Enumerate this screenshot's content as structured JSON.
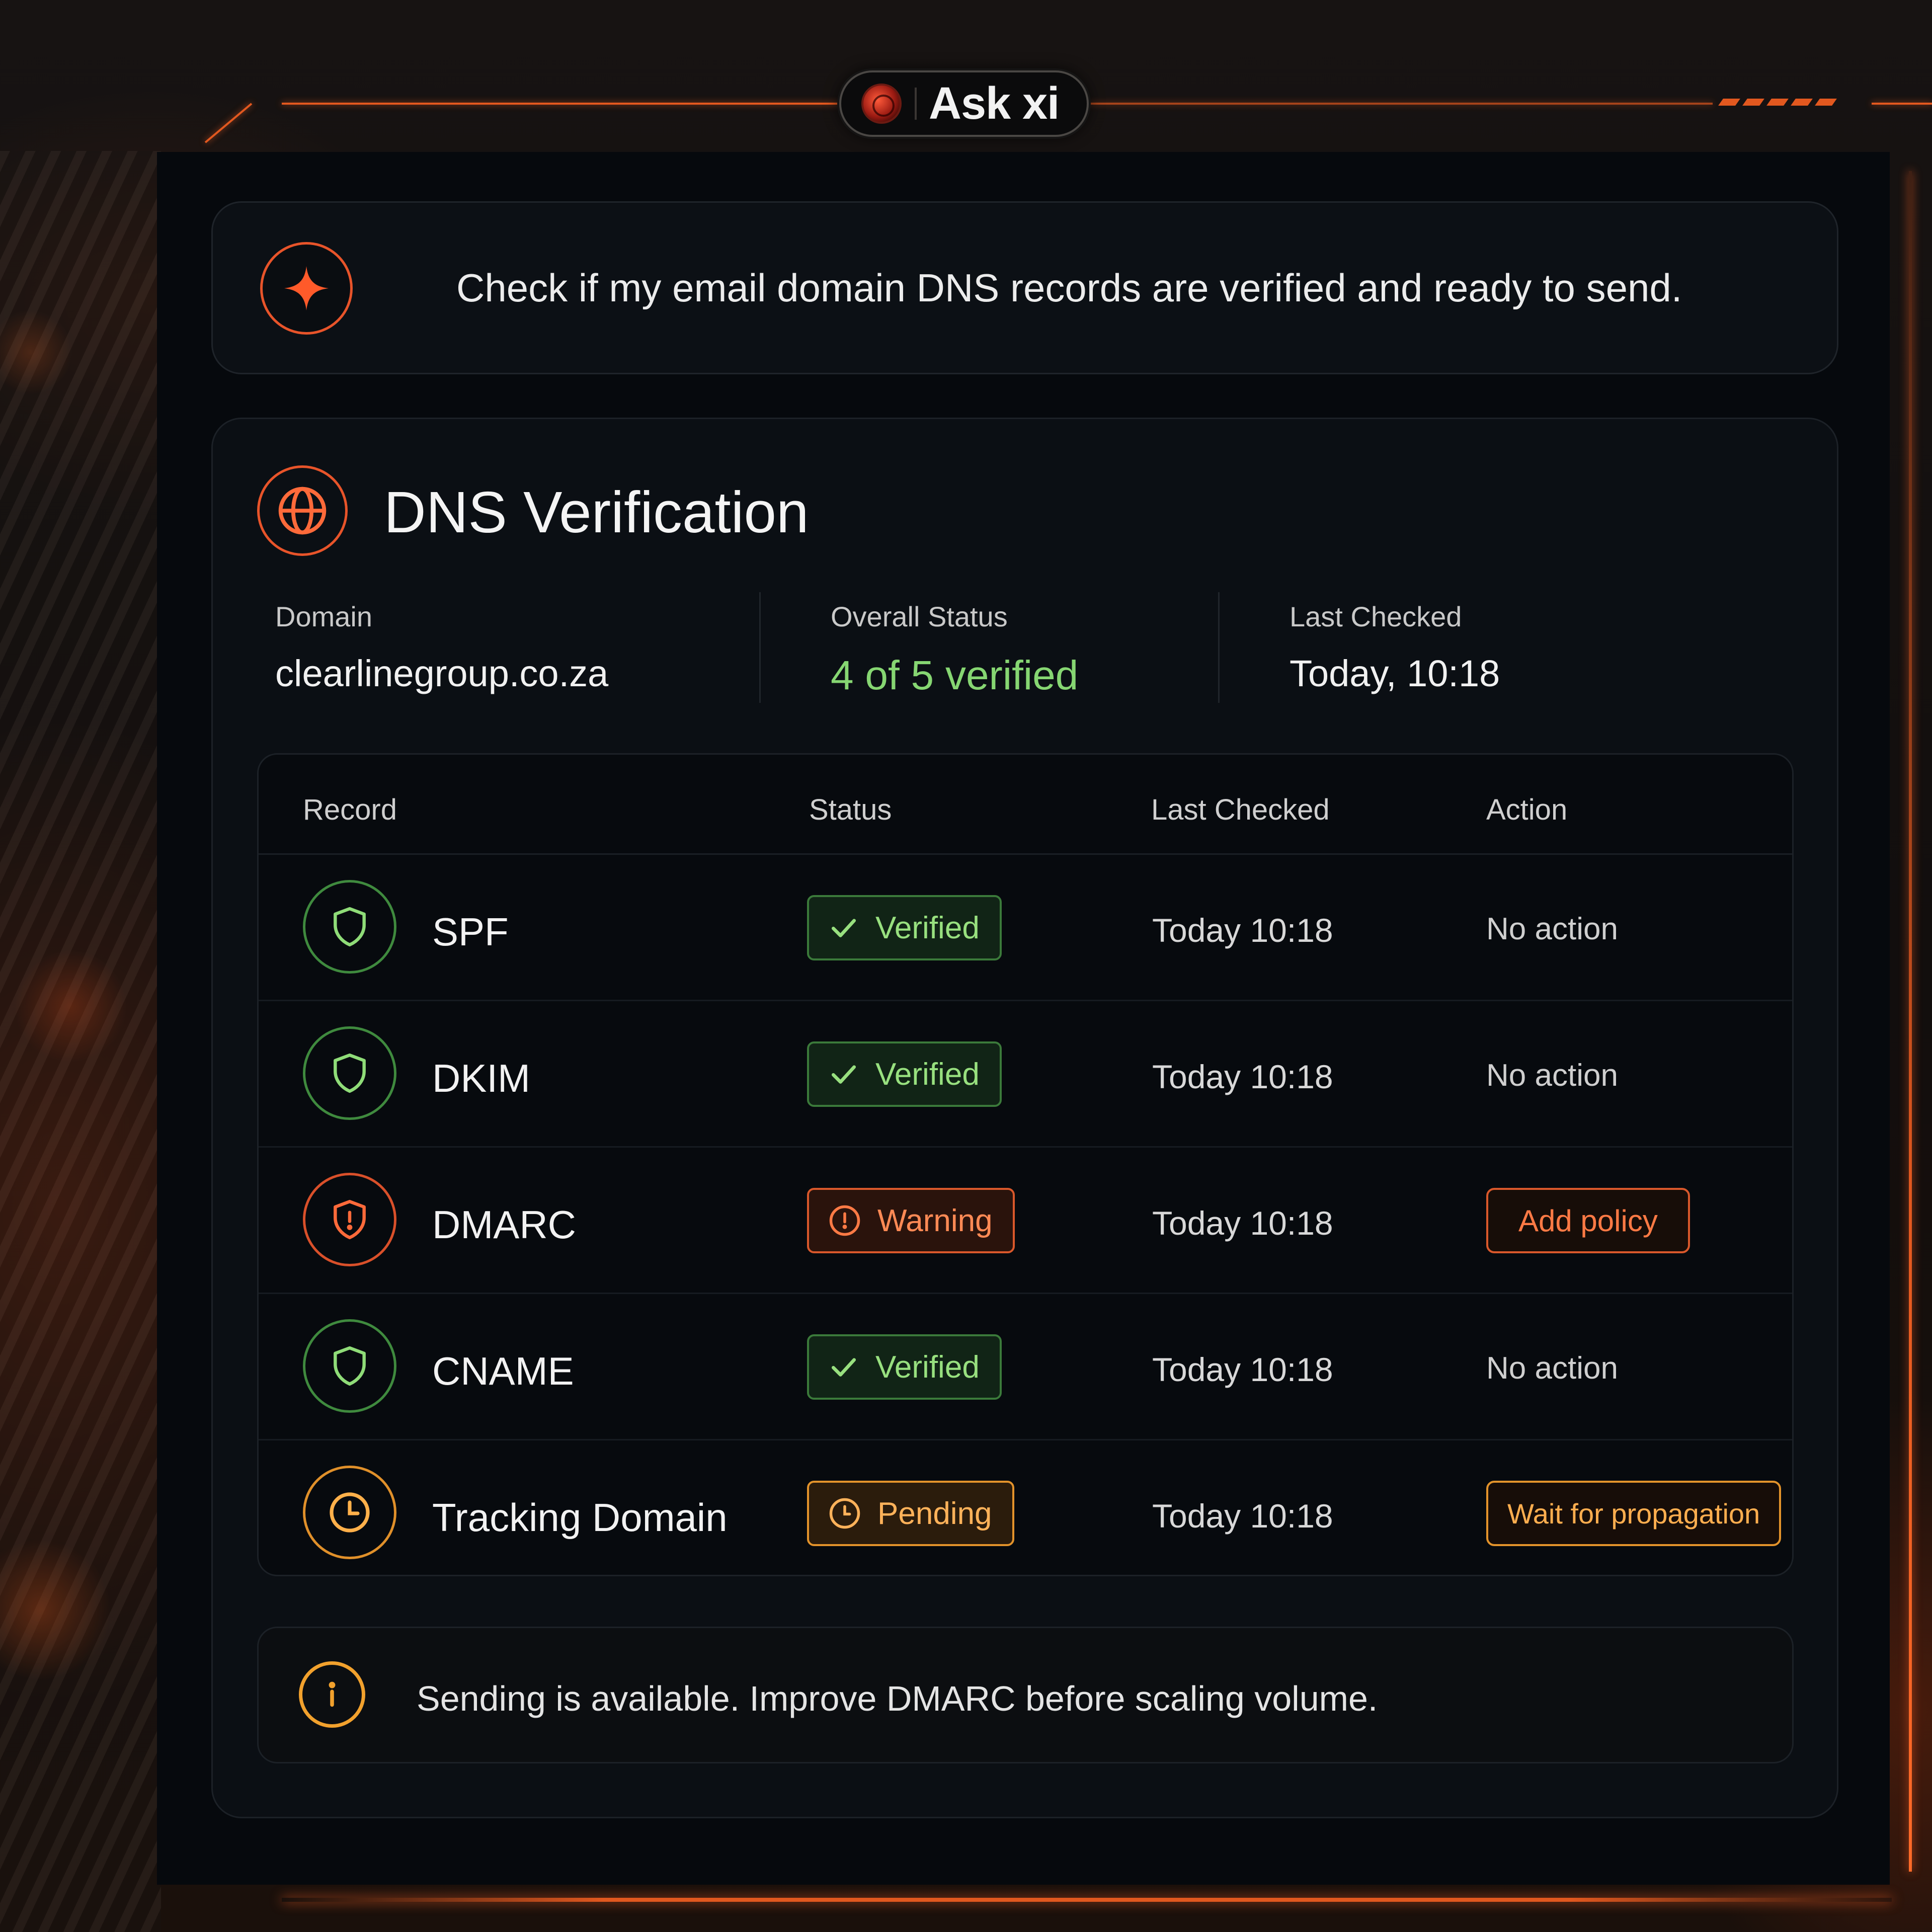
{
  "app": {
    "name": "Ask xi",
    "orb_icon": "xi-orb-icon"
  },
  "prompt": {
    "icon": "sparkle-icon",
    "text": "Check if my email domain DNS records are verified and ready to send."
  },
  "dns": {
    "icon": "globe-icon",
    "title": "DNS Verification",
    "summary": {
      "domain_label": "Domain",
      "domain_value": "clearlinegroup.co.za",
      "status_label": "Overall Status",
      "status_value": "4 of 5 verified",
      "checked_label": "Last Checked",
      "checked_value": "Today, 10:18"
    },
    "table": {
      "headers": {
        "record": "Record",
        "status": "Status",
        "last_checked": "Last Checked",
        "action": "Action"
      },
      "rows": [
        {
          "record": "SPF",
          "status": "Verified",
          "last_checked": "Today 10:18",
          "action": "No action"
        },
        {
          "record": "DKIM",
          "status": "Verified",
          "last_checked": "Today 10:18",
          "action": "No action"
        },
        {
          "record": "DMARC",
          "status": "Warning",
          "last_checked": "Today 10:18",
          "action": "Add policy"
        },
        {
          "record": "CNAME",
          "status": "Verified",
          "last_checked": "Today 10:18",
          "action": "No action"
        },
        {
          "record": "Tracking Domain",
          "status": "Pending",
          "last_checked": "Today 10:18",
          "action": "Wait for propagation"
        }
      ]
    },
    "note": {
      "icon": "info-icon",
      "text": "Sending is available. Improve DMARC before scaling volume."
    }
  },
  "colors": {
    "accent": "#e8542a",
    "verified": "#86d672",
    "warning": "#ff8a55",
    "pending": "#ffb25a",
    "info": "#f2a12d"
  }
}
